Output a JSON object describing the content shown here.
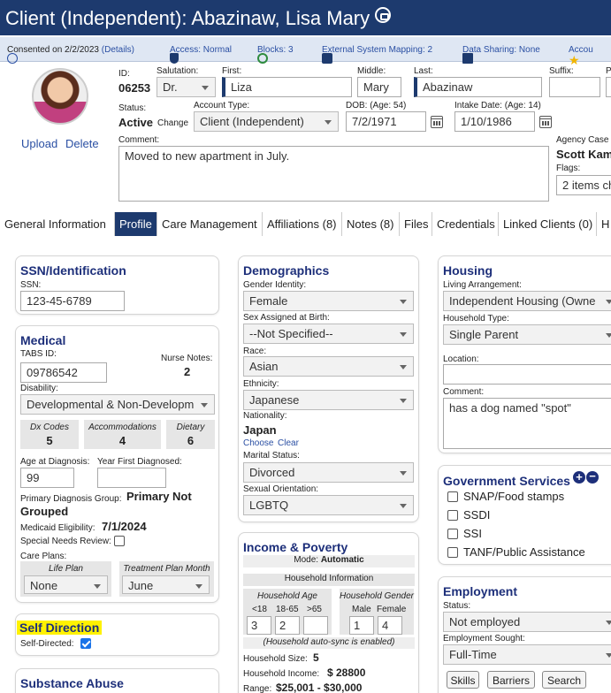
{
  "header": {
    "title": "Client (Independent): Abazinaw, Lisa Mary"
  },
  "infobar": {
    "consent": "Consented on 2/2/2023",
    "details": "(Details)",
    "access": "Access: Normal",
    "blocks": "Blocks: 3",
    "external": "External System Mapping: 2",
    "sharing": "Data Sharing: None",
    "account": "Accou"
  },
  "profile": {
    "upload": "Upload",
    "delete": "Delete",
    "id_label": "ID:",
    "id": "06253",
    "salutation_label": "Salutation:",
    "salutation": "Dr.",
    "first_label": "First:",
    "first": "Liza",
    "middle_label": "Middle:",
    "middle": "Mary",
    "last_label": "Last:",
    "last": "Abazinaw",
    "suffix_label": "Suffix:",
    "p_label": "P",
    "status_label": "Status:",
    "status": "Active",
    "change": "Change",
    "account_type_label": "Account Type:",
    "account_type": "Client (Independent)",
    "dob_label": "DOB: (Age: 54)",
    "dob": "7/2/1971",
    "intake_label": "Intake Date: (Age: 14)",
    "intake": "1/10/1986",
    "comment_label": "Comment:",
    "comment": "Moved to new apartment in July.",
    "agency_label": "Agency Case",
    "agency": "Scott Kam",
    "flags_label": "Flags:",
    "flags": "2 items ch"
  },
  "tabs": [
    "General Information",
    "Profile",
    "Care Management",
    "Affiliations (8)",
    "Notes (8)",
    "Files",
    "Credentials",
    "Linked Clients (0)",
    "H"
  ],
  "ssn": {
    "title": "SSN/Identification",
    "label": "SSN:",
    "value": "123-45-6789"
  },
  "medical": {
    "title": "Medical",
    "tabs_label": "TABS ID:",
    "tabs_id": "09786542",
    "nurse_label": "Nurse Notes:",
    "nurse": "2",
    "disability_label": "Disability:",
    "disability": "Developmental & Non-Developm",
    "dx_label": "Dx Codes",
    "dx": "5",
    "acc_label": "Accommodations",
    "acc": "4",
    "diet_label": "Dietary",
    "diet": "6",
    "age_label": "Age at Diagnosis:",
    "age": "99",
    "year_label": "Year First Diagnosed:",
    "pdg_label": "Primary Diagnosis Group:",
    "pdg1": "Primary Not",
    "pdg2": "Grouped",
    "elig_label": "Medicaid Eligibility:",
    "elig": "7/1/2024",
    "snr_label": "Special Needs Review:",
    "care_label": "Care Plans:",
    "life_label": "Life Plan",
    "life": "None",
    "treat_label": "Treatment Plan Month",
    "treat": "June"
  },
  "self_direction": {
    "title": "Self Direction",
    "label": "Self-Directed:"
  },
  "substance": {
    "title": "Substance Abuse"
  },
  "demographics": {
    "title": "Demographics",
    "gender_label": "Gender Identity:",
    "gender": "Female",
    "sex_label": "Sex Assigned at Birth:",
    "sex": "--Not Specified--",
    "race_label": "Race:",
    "race": "Asian",
    "eth_label": "Ethnicity:",
    "eth": "Japanese",
    "nat_label": "Nationality:",
    "nat": "Japan",
    "choose": "Choose",
    "clear": "Clear",
    "marital_label": "Marital Status:",
    "marital": "Divorced",
    "orient_label": "Sexual Orientation:",
    "orient": "LGBTQ"
  },
  "income": {
    "title": "Income & Poverty",
    "mode_label": "Mode:",
    "mode": "Automatic",
    "hh_info": "Household Information",
    "age_label": "Household Age",
    "gender_label": "Household Gender",
    "u18": "<18",
    "a1865": "18-65",
    "o65": ">65",
    "male": "Male",
    "female": "Female",
    "v1": "3",
    "v2": "2",
    "v3": "",
    "v4": "1",
    "v5": "4",
    "auto": "(Household auto-sync is enabled)",
    "size_label": "Household Size:",
    "size": "5",
    "inc_label": "Household Income:",
    "inc": "$ 28800",
    "range_label": "Range:",
    "range": "$25,001 - $30,000"
  },
  "housing": {
    "title": "Housing",
    "living_label": "Living Arrangement:",
    "living": "Independent Housing (Owne",
    "type_label": "Household Type:",
    "type": "Single Parent",
    "loc_label": "Location:",
    "comment_label": "Comment:",
    "comment": "has a dog named \"spot\""
  },
  "gov": {
    "title": "Government Services",
    "items": [
      "SNAP/Food stamps",
      "SSDI",
      "SSI",
      "TANF/Public Assistance"
    ]
  },
  "employment": {
    "title": "Employment",
    "status_label": "Status:",
    "status": "Not employed",
    "sought_label": "Employment Sought:",
    "sought": "Full-Time",
    "skills": "Skills",
    "barriers": "Barriers",
    "search": "Search"
  },
  "colors": {
    "navy": "#1d3a6e",
    "heading": "#1d2f7a",
    "link": "#2a4fa3",
    "highlight": "#fff200"
  }
}
